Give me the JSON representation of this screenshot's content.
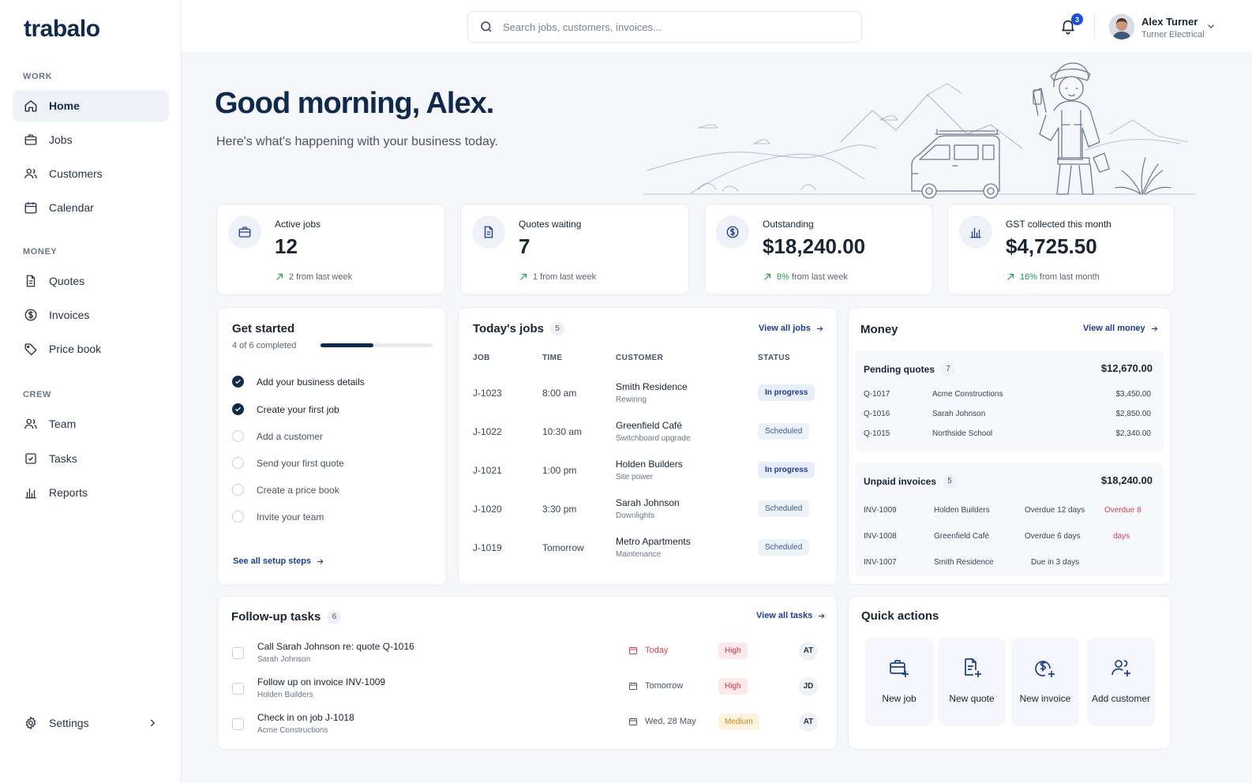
{
  "app": {
    "logo": "trabalo"
  },
  "sidebar": {
    "sections": {
      "work": "WORK",
      "money": "MONEY",
      "crew": "CREW"
    },
    "items": [
      {
        "label": "Home",
        "icon": "home-icon"
      },
      {
        "label": "Jobs",
        "icon": "briefcase-icon"
      },
      {
        "label": "Customers",
        "icon": "users-icon"
      },
      {
        "label": "Calendar",
        "icon": "calendar-icon"
      },
      {
        "label": "Quotes",
        "icon": "document-icon"
      },
      {
        "label": "Invoices",
        "icon": "dollar-icon"
      },
      {
        "label": "Price book",
        "icon": "tag-icon"
      },
      {
        "label": "Team",
        "icon": "team-icon"
      },
      {
        "label": "Tasks",
        "icon": "checkbox-icon"
      },
      {
        "label": "Reports",
        "icon": "bar-chart-icon"
      }
    ],
    "settings": "Settings"
  },
  "topbar": {
    "search_placeholder": "Search jobs, customers, invoices...",
    "notifications": "3",
    "user_name": "Alex Turner",
    "user_company": "Turner Electrical"
  },
  "hero": {
    "greeting": "Good morning, Alex.",
    "subtitle": "Here's what's happening with your business today."
  },
  "stats": [
    {
      "label": "Active jobs",
      "value": "12",
      "change_pct": "",
      "change": "2 from last week"
    },
    {
      "label": "Quotes waiting",
      "value": "7",
      "change_pct": "",
      "change": "1 from last week"
    },
    {
      "label": "Outstanding",
      "value": "$18,240.00",
      "change_pct": "8%",
      "change": "from last week"
    },
    {
      "label": "GST collected this month",
      "value": "$4,725.50",
      "change_pct": "16%",
      "change": "from last month"
    }
  ],
  "get_started": {
    "title": "Get started",
    "progress_text": "4 of 6 completed",
    "progress": 0.47,
    "steps": [
      {
        "label": "Add your business details",
        "done": true
      },
      {
        "label": "Create your first job",
        "done": true
      },
      {
        "label": "Add a customer",
        "done": false
      },
      {
        "label": "Send your first quote",
        "done": false
      },
      {
        "label": "Create a price book",
        "done": false
      },
      {
        "label": "Invite your team",
        "done": false
      }
    ],
    "link": "See all setup steps"
  },
  "todays_jobs": {
    "title": "Today's jobs",
    "count": "5",
    "link": "View all jobs",
    "headers": [
      "JOB",
      "TIME",
      "CUSTOMER",
      "STATUS"
    ],
    "rows": [
      {
        "id": "J-1023",
        "time": "8:00 am",
        "customer": "Smith Residence",
        "desc": "Rewiring",
        "status": "In progress"
      },
      {
        "id": "J-1022",
        "time": "10:30 am",
        "customer": "Greenfield Café",
        "desc": "Switchboard upgrade",
        "status": "Scheduled"
      },
      {
        "id": "J-1021",
        "time": "1:00 pm",
        "customer": "Holden Builders",
        "desc": "Site power",
        "status": "In progress"
      },
      {
        "id": "J-1020",
        "time": "3:30 pm",
        "customer": "Sarah Johnson",
        "desc": "Downlights",
        "status": "Scheduled"
      },
      {
        "id": "J-1019",
        "time": "Tomorrow",
        "customer": "Metro Apartments",
        "desc": "Maintenance",
        "status": "Scheduled"
      }
    ]
  },
  "money": {
    "title": "Money",
    "link": "View all money",
    "pending": {
      "title": "Pending quotes",
      "count": "7",
      "total": "$12,670.00",
      "rows": [
        {
          "id": "Q-1017",
          "name": "Acme Constructions",
          "amount": "$3,450.00"
        },
        {
          "id": "Q-1016",
          "name": "Sarah Johnson",
          "amount": "$2,850.00"
        },
        {
          "id": "Q-1015",
          "name": "Northside School",
          "amount": "$2,340.00"
        }
      ]
    },
    "unpaid": {
      "title": "Unpaid invoices",
      "count": "5",
      "total": "$18,240.00",
      "rows": [
        {
          "id": "INV-1009",
          "name": "Holden Builders",
          "due": "Overdue 12 days",
          "flag": "Overdue 8"
        },
        {
          "id": "INV-1008",
          "name": "Greenfield Café",
          "due": "Overdue 6 days",
          "flag": "days"
        },
        {
          "id": "INV-1007",
          "name": "Smith Residence",
          "due": "Due in 3 days",
          "flag": ""
        }
      ]
    }
  },
  "followup": {
    "title": "Follow-up tasks",
    "count": "6",
    "link": "View all tasks",
    "rows": [
      {
        "title": "Call Sarah Johnson re: quote Q-1016",
        "sub": "Sarah Johnson",
        "date": "Today",
        "priority": "High",
        "initials": "AT"
      },
      {
        "title": "Follow up on invoice INV-1009",
        "sub": "Holden Builders",
        "date": "Tomorrow",
        "priority": "High",
        "initials": "JD"
      },
      {
        "title": "Check in on job J-1018",
        "sub": "Acme Constructions",
        "date": "Wed, 28 May",
        "priority": "Medium",
        "initials": "AT"
      }
    ]
  },
  "quick_actions": {
    "title": "Quick actions",
    "items": [
      {
        "label": "New job",
        "icon": "briefcase-plus-icon"
      },
      {
        "label": "New quote",
        "icon": "document-plus-icon"
      },
      {
        "label": "New invoice",
        "icon": "dollar-plus-icon"
      },
      {
        "label": "Add customer",
        "icon": "user-plus-icon"
      }
    ]
  },
  "colors": {
    "brand": "#0f2a4d",
    "accent": "#1e4fd8",
    "positive": "#1f9d55",
    "danger": "#d6404f",
    "warning": "#c7861c"
  }
}
